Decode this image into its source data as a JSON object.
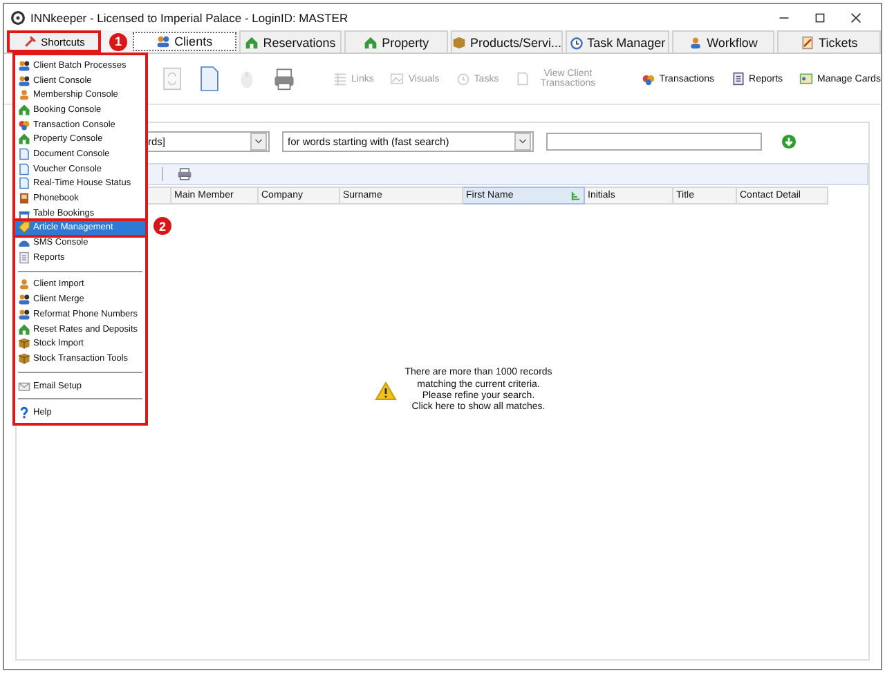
{
  "window": {
    "title": "INNkeeper - Licensed to Imperial Palace - LoginID: MASTER"
  },
  "shortcuts_button": {
    "label": "Shortcuts",
    "badge": "1"
  },
  "tabs": [
    {
      "label": "Clients",
      "selected": true
    },
    {
      "label": "Reservations",
      "selected": false
    },
    {
      "label": "Property",
      "selected": false
    },
    {
      "label": "Products/Servi...",
      "selected": false
    },
    {
      "label": "Task Manager",
      "selected": false
    },
    {
      "label": "Workflow",
      "selected": false
    },
    {
      "label": "Tickets",
      "selected": false
    }
  ],
  "toolbar": [
    {
      "kind": "icon",
      "disabled": true
    },
    {
      "kind": "icon",
      "disabled": false
    },
    {
      "kind": "icon",
      "disabled": true
    },
    {
      "kind": "icon",
      "disabled": false
    },
    {
      "kind": "separator"
    },
    {
      "kind": "button",
      "label": "Links",
      "disabled": true
    },
    {
      "kind": "button",
      "label": "Visuals",
      "disabled": true
    },
    {
      "kind": "button",
      "label": "Tasks",
      "disabled": true
    },
    {
      "kind": "button",
      "label": "View Client Transactions",
      "disabled": true
    },
    {
      "kind": "separator"
    },
    {
      "kind": "button",
      "label": "Transactions",
      "disabled": false
    },
    {
      "kind": "button",
      "label": "Reports",
      "disabled": false
    },
    {
      "kind": "button",
      "label": "Manage Cards",
      "disabled": false
    }
  ],
  "search": {
    "field_combo": "rds]",
    "mode_combo": "for words starting with (fast search)"
  },
  "table": {
    "columns": [
      {
        "label": "Main Member",
        "selected": false
      },
      {
        "label": "Company",
        "selected": false
      },
      {
        "label": "Surname",
        "selected": false
      },
      {
        "label": "First Name",
        "selected": true
      },
      {
        "label": "Initials",
        "selected": false
      },
      {
        "label": "Title",
        "selected": false
      },
      {
        "label": "Contact Detail",
        "selected": false
      }
    ],
    "message": [
      "There are more than 1000 records",
      "matching the current criteria.",
      "Please refine your search.",
      "Click here to show all matches."
    ]
  },
  "shortcuts_menu": {
    "badge": "2",
    "sections": [
      [
        {
          "label": "Client Batch Processes",
          "selected": false
        },
        {
          "label": "Client Console",
          "selected": false
        },
        {
          "label": "Membership Console",
          "selected": false
        },
        {
          "label": "Booking Console",
          "selected": false
        },
        {
          "label": "Transaction Console",
          "selected": false
        },
        {
          "label": "Property Console",
          "selected": false
        },
        {
          "label": "Document Console",
          "selected": false
        },
        {
          "label": "Voucher Console",
          "selected": false
        },
        {
          "label": "Real-Time House Status",
          "selected": false
        },
        {
          "label": "Phonebook",
          "selected": false
        },
        {
          "label": "Table Bookings",
          "selected": false
        },
        {
          "label": "Article Management",
          "selected": true
        },
        {
          "label": "SMS Console",
          "selected": false
        },
        {
          "label": "Reports",
          "selected": false
        }
      ],
      [
        {
          "label": "Client Import",
          "selected": false
        },
        {
          "label": "Client Merge",
          "selected": false
        },
        {
          "label": "Reformat Phone Numbers",
          "selected": false
        },
        {
          "label": "Reset Rates and Deposits",
          "selected": false
        },
        {
          "label": "Stock Import",
          "selected": false
        },
        {
          "label": "Stock Transaction Tools",
          "selected": false
        }
      ],
      [
        {
          "label": "Email Setup",
          "selected": false
        }
      ],
      [
        {
          "label": "Help",
          "selected": false
        }
      ]
    ]
  }
}
